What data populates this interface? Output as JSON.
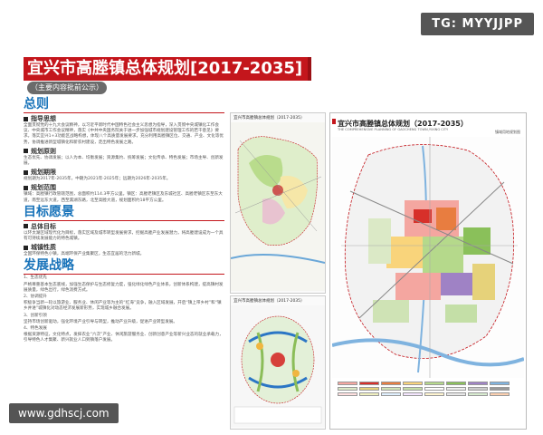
{
  "watermark_top": "TG: MYYJJPP",
  "watermark_bottom": "www.gdhscj.com",
  "title": "宜兴市高塍镇总体规划[2017-2035]",
  "subtitle": "（主要内容批前公示）",
  "sections": {
    "general": "总则",
    "guiding": "指导思想",
    "guiding_text": "全面贯彻党的十九大会议精神，以习近平新时代中国特色社会主义思想为指导，深入贯彻中央城镇化工作会议、中央城市工作会议精神，落实《中共中央国务院关于进一步加强城市规划建设管理工作的若干意见》要求。落实宜兴1+3功能区战略构想，体现八个高质量发展要求，充分利用高塍镇区位、交通、产业、文化等优势，协调推进新型城镇化和新农村建设，走出特色发展之路。",
    "principle": "规划原则",
    "principle_text": "生态优先、协调发展；以人为本、均衡发展；资源集约、统筹发展；文化传承、特色发展；市场主导、创新发展。",
    "period": "规划期限",
    "period_text": "规划期为2017年-2035年，中期为2021年-2025年；远期为2026年-2035年。",
    "scope": "规划范围",
    "scope_text": "镇域：高塍镇行政管辖范围，总面积约114.3平方公里。镇区：高塍老镇区及东城社区、高塍老镇区东至东大道，南至远东大道，西至漏湖东路，北至高塍大道，规划面积约18平方公里。",
    "target_vision": "目标愿景",
    "overall_target": "总体目标",
    "overall_text": "以环太湖区域现代化为目标，落实区域及城市转型发展要求，挖掘高塍产业发展潜力，将高塍建设成为一个具有可持续发展能力的特色城镇。",
    "nature": "城镇性质",
    "nature_text": "全国环保特色小镇，高端环保产业集聚区，生态宜居的活力新城。",
    "strategy": "发展战略",
    "strategy_text_1": "1、生态优先",
    "strategy_text_2": "严格尊重基本生态底线，加强生态保护与生态修复力度，强化绿化绿色产业体系，创新体系构建，提高镇村发展质量，绿色出行，绿色消费方式。",
    "strategy_text_3": "2、协调提升",
    "strategy_text_4": "积极争当新一轮以旅游业、服务业、休闲产业等为主的“红海”竞争，融入区域发展，开启“镇上带乡村”和“镇乡并进”城镇化对动态经济发展新形势，实现城乡融合发展。",
    "strategy_text_5": "3、创新引领",
    "strategy_text_6": "坚持市场创新驱动，强化环境产业引导与转型，推动产业升级，促进产业转型发展。",
    "strategy_text_7": "4、特色发展",
    "strategy_text_8": "根据资源特征，文化特点，发挥农业“六次”产业、休闲旅游服务业、创新创意产业等新兴业态的就业承载力，引导特色人才集聚、新兴就业人口到镇落户发展。"
  },
  "panel_a_title": "宜兴市高塍镇总体规划（2017-2035）",
  "panel_b_title": "宜兴市高塍镇总体规划（2017-2035）",
  "main_map": {
    "title": "宜兴市高塍镇总体规划（2017-2035）",
    "subtitle": "THE COMPREHENSIVE PLANNING OF GAOCHENG TOWN,YIXING CITY",
    "corner": "镇域用地规划图"
  },
  "colors": {
    "brand_red": "#c4161c",
    "heading_blue": "#1a74ba"
  }
}
